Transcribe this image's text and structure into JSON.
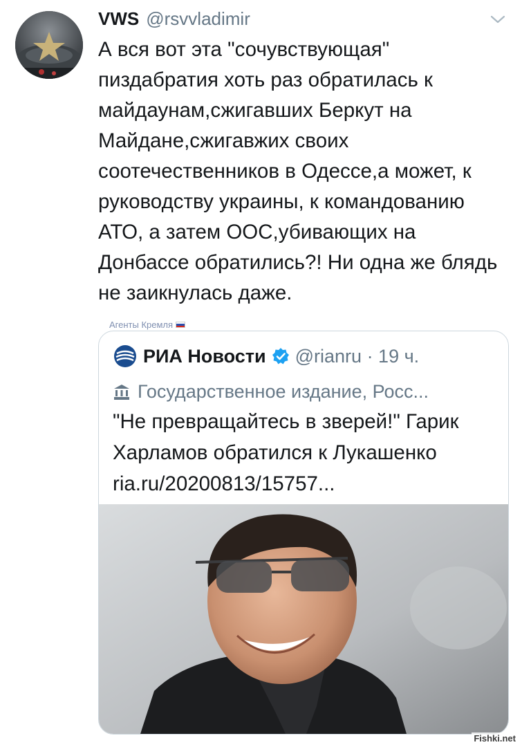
{
  "tweet": {
    "display_name": "VWS",
    "handle": "@rsvvladimir",
    "text": "А вся вот эта \"сочувствующая\" пиздабратия хоть раз обратилась к майдаунам,сжигавших Беркут на Майдане,сжигавжих своих соотечественников в Одессе,а может, к руководству украины, к командованию АТО, а затем ООС,убивающих на Донбассе обратились?! Ни одна же блядь не заикнулась даже.",
    "badge_label": "Агенты Кремля",
    "icons": [
      "avatar",
      "chevron-down-icon",
      "russian-flag-icon"
    ]
  },
  "quoted": {
    "source_name": "РИА Новости",
    "handle": "@rianru · 19 ч.",
    "label": "Государственное издание, Росс...",
    "text_line1": "\"Не превращайтесь в зверей!\" Гарик Харламов обратился к Лукашенко",
    "link": "ria.ru/20200813/15757...",
    "icons": [
      "ria-logo-icon",
      "verified-badge-icon",
      "government-building-icon"
    ]
  },
  "watermark": "Fishki.net",
  "colors": {
    "text": "#14171a",
    "secondary": "#657786",
    "border": "#ccd6dd",
    "ria_blue": "#1a4c8f",
    "verified": "#1da1f2"
  }
}
